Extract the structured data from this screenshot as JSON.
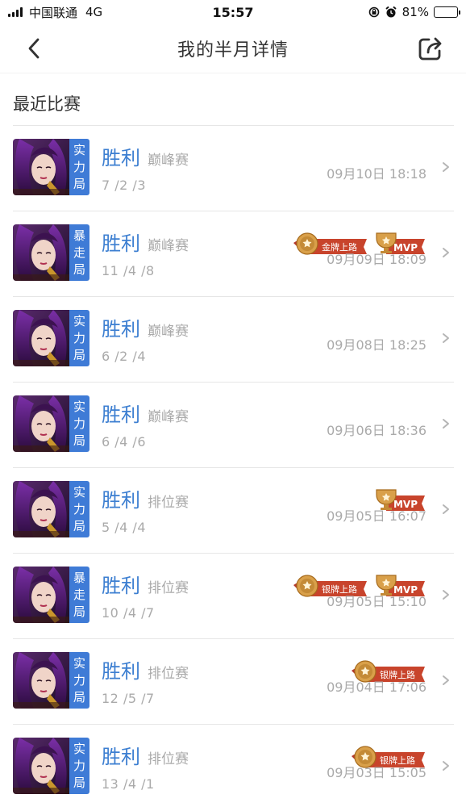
{
  "status": {
    "carrier": "中国联通",
    "network": "4G",
    "time": "15:57",
    "battery": "81%",
    "battery_level": 0.81
  },
  "nav": {
    "title": "我的半月详情"
  },
  "section_title": "最近比赛",
  "badge_text": {
    "gold": "金牌上路",
    "silver": "银牌上路",
    "mvp": "MVP"
  },
  "matches": [
    {
      "tag": [
        "实",
        "力",
        "局"
      ],
      "result": "胜利",
      "mode": "巅峰赛",
      "kda": "7 /2 /3",
      "time": "09月10日 18:18",
      "badges": []
    },
    {
      "tag": [
        "暴",
        "走",
        "局"
      ],
      "result": "胜利",
      "mode": "巅峰赛",
      "kda": "11 /4 /8",
      "time": "09月09日 18:09",
      "badges": [
        "gold",
        "mvp"
      ]
    },
    {
      "tag": [
        "实",
        "力",
        "局"
      ],
      "result": "胜利",
      "mode": "巅峰赛",
      "kda": "6 /2 /4",
      "time": "09月08日 18:25",
      "badges": []
    },
    {
      "tag": [
        "实",
        "力",
        "局"
      ],
      "result": "胜利",
      "mode": "巅峰赛",
      "kda": "6 /4 /6",
      "time": "09月06日 18:36",
      "badges": []
    },
    {
      "tag": [
        "实",
        "力",
        "局"
      ],
      "result": "胜利",
      "mode": "排位赛",
      "kda": "5 /4 /4",
      "time": "09月05日 16:07",
      "badges": [
        "mvp"
      ]
    },
    {
      "tag": [
        "暴",
        "走",
        "局"
      ],
      "result": "胜利",
      "mode": "排位赛",
      "kda": "10 /4 /7",
      "time": "09月05日 15:10",
      "badges": [
        "silver",
        "mvp"
      ]
    },
    {
      "tag": [
        "实",
        "力",
        "局"
      ],
      "result": "胜利",
      "mode": "排位赛",
      "kda": "12 /5 /7",
      "time": "09月04日 17:06",
      "badges": [
        "silver"
      ]
    },
    {
      "tag": [
        "实",
        "力",
        "局"
      ],
      "result": "胜利",
      "mode": "排位赛",
      "kda": "13 /4 /1",
      "time": "09月03日 15:05",
      "badges": [
        "silver"
      ]
    }
  ]
}
